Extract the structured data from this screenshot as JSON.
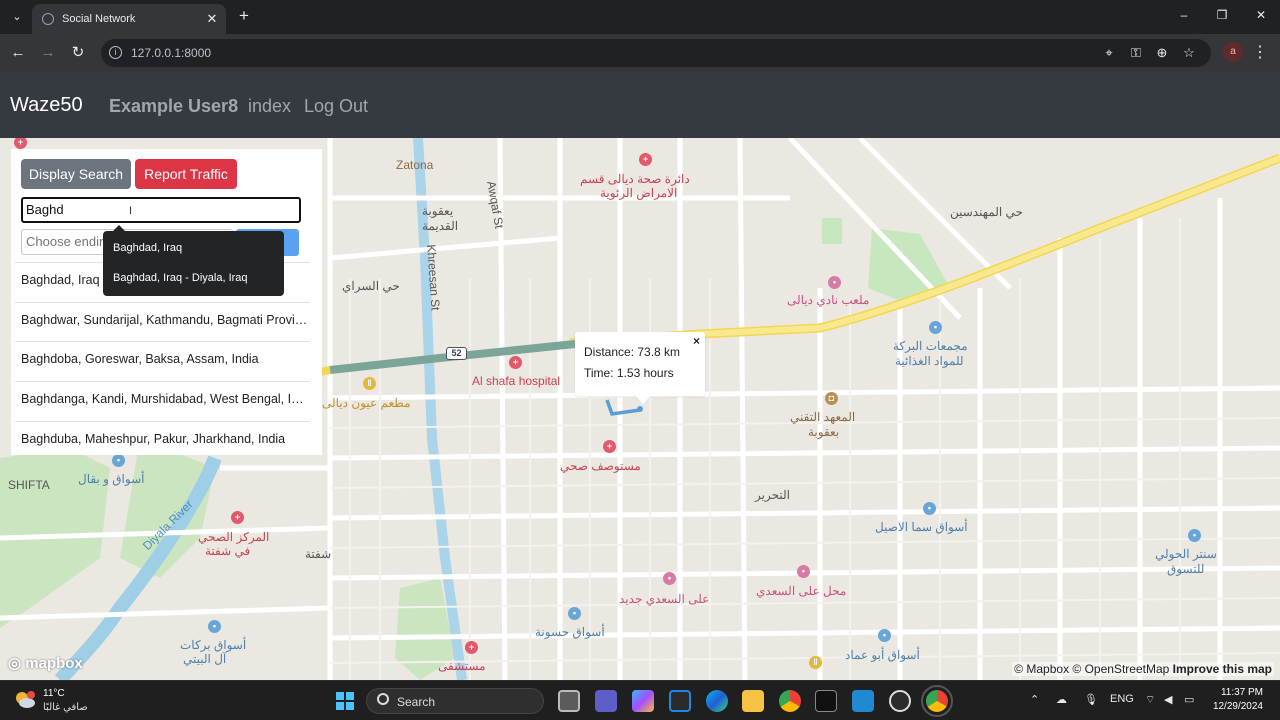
{
  "browser": {
    "tab_title": "Social Network",
    "tab_close": "✕",
    "new_tab": "+",
    "url": "127.0.0.1:8000",
    "profile_initial": "a",
    "menu_icon": "kebab-menu-icon"
  },
  "navbar": {
    "brand": "Waze50",
    "user": "Example User8",
    "links": [
      "index",
      "Log Out"
    ]
  },
  "panel": {
    "display_search_label": "Display Search",
    "report_traffic_label": "Report Traffic",
    "search_value": "Baghd",
    "end_placeholder": "Choose ending",
    "results": [
      "Baghdad, Iraq",
      "Baghdwar, Sundarijal, Kathmandu, Bagmati Province, Nepal",
      "Baghdoba, Goreswar, Baksa, Assam, India",
      "Baghdanga, Kandi, Murshidabad, West Bengal, India",
      "Baghduba, Maheshpur, Pakur, Jharkhand, India"
    ],
    "suggestions": [
      "Baghdad, Iraq",
      "Baghdad, Iraq - Diyala, Iraq"
    ]
  },
  "popup": {
    "distance": "Distance: 73.8 km",
    "time": "Time: 1.53 hours",
    "close": "×"
  },
  "map": {
    "labels": {
      "zatona": "Zatona",
      "awqaf": "Awqaf St",
      "health_dept": "دائرة صحة ديالى قسم",
      "health_dept2": "الامراض الرئوية",
      "engineers": "حي المهندسين",
      "yaqubia": "يعقوبة",
      "yaqubia2": "القديمة",
      "khreesan": "Khreesan St",
      "sarai": "حي السراي",
      "stadium": "ملعب نادي ديالى",
      "baraka": "مجمعات البركة",
      "baraka2": "للمواد الغذائية",
      "shafa": "Al shafa hospital",
      "restaurant": "مطعم عيون ديالى",
      "institute": "المعهد التقني",
      "institute2": "بعقوبة",
      "clinic": "مستوصف صحي",
      "tahrir": "التحرير",
      "shifta": "SHIFTA",
      "market": "أسواق و بقال",
      "health_center": "المركز الصحي",
      "health_center2": "في شفتة",
      "diyala_river": "Diyala River",
      "shifta_ar": "شفتة",
      "asil": "أسواق سما الاصيل",
      "saadi": "على السعدي جديد",
      "saadi2": "محل على السعدي",
      "souk": "سنتر الحولي",
      "souk2": "للتسوق",
      "barakat": "أسواق بركات",
      "barakat2": "آل البيتي",
      "hosna": "أسواق حسونة",
      "amad": "أسواق أبو عماد",
      "hospital": "مستشفى",
      "route_shield": "52"
    },
    "logo": "mapbox",
    "attribution": "© Mapbox © OpenStreetMap",
    "improve": "Improve this map"
  },
  "taskbar": {
    "temp": "11°C",
    "weather_desc": "صافي غالبًا",
    "search_label": "Search",
    "lang": "ENG",
    "time": "11:37 PM",
    "date": "12/29/2024"
  },
  "colors": {
    "navbar_bg": "#343a40",
    "btn_gray": "#6c757d",
    "btn_red": "#dc3545",
    "route": "#5a9fd4",
    "highway": "#f7e16b"
  }
}
